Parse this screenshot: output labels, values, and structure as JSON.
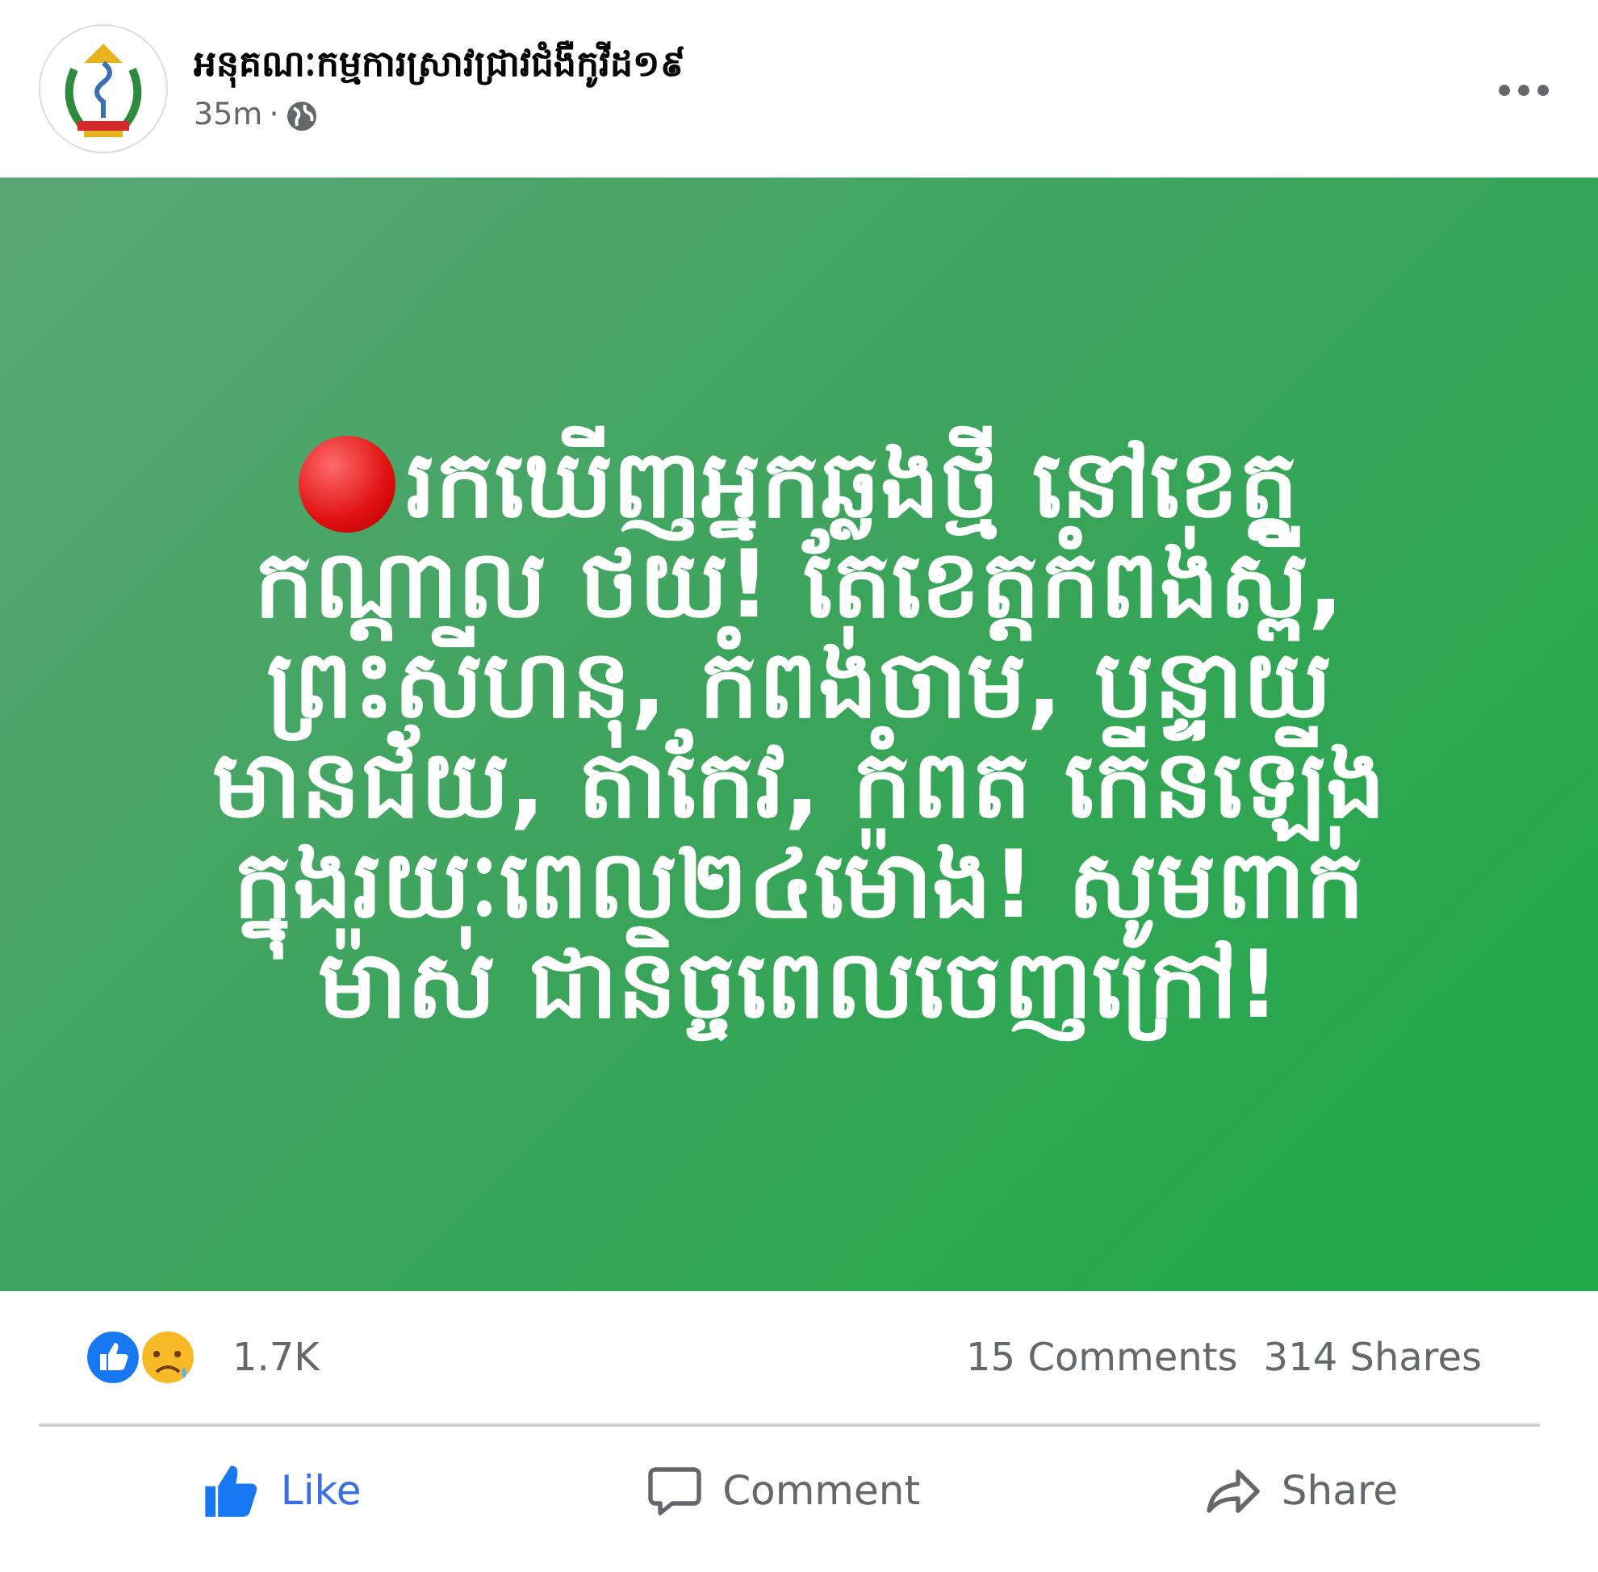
{
  "post": {
    "author": "អនុគណៈកម្មការស្រាវជ្រាវជំងឺកូវីដ១៩",
    "time": "35m",
    "separator": "·",
    "public": true
  },
  "card": {
    "lines": [
      "រកឃើញអ្នកឆ្លងថ្មី នៅខេត្ត",
      "កណ្ដាល ថយ! តែខេត្តកំពង់ស្ពឺ,",
      "ព្រះសីហនុ, កំពង់ចាម, បន្ទាយ",
      "មានជ័យ, តាកែវ, កំពត កើនឡើង",
      "ក្នុងរយៈពេល២៤ម៉ោង! សូមពាក់",
      "ម៉ាស់ ជានិច្ចពេលចេញក្រៅ!"
    ]
  },
  "reactions": {
    "count": "1.7K",
    "comments": "15 Comments",
    "shares": "314 Shares"
  },
  "actions": [
    {
      "kind": "like",
      "label": "Like",
      "selected": true
    },
    {
      "kind": "comment",
      "label": "Comment",
      "selected": false
    },
    {
      "kind": "share",
      "label": "Share",
      "selected": false
    }
  ]
}
